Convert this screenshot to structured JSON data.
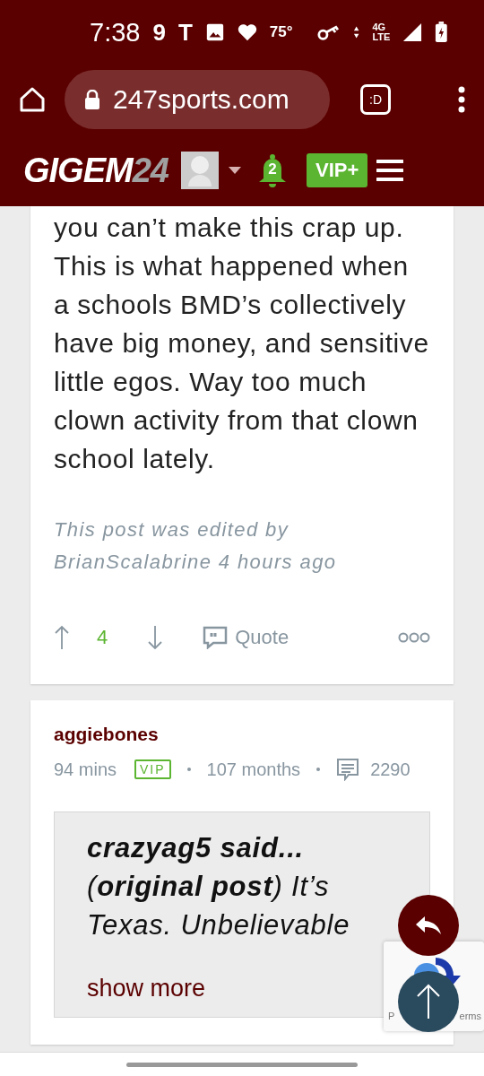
{
  "status_bar": {
    "time": "7:38",
    "notification_glyphs": [
      "9",
      "T"
    ],
    "temperature": "75°",
    "network_top": "4G",
    "network_bottom": "LTE"
  },
  "browser": {
    "url": "247sports.com",
    "tab_label": ":D"
  },
  "site_header": {
    "logo_main": "GIGEM",
    "logo_tail": "24",
    "notification_count": "2",
    "vip_label": "VIP+"
  },
  "posts": [
    {
      "kind": "continued",
      "body": "you can’t make this crap up. This is what happened when a schools BMD’s collectively have big money, and sensitive little egos. Way too much clown activity from that clown school lately.",
      "edited_note": "This post was edited by BrianScalabrine 4 hours ago",
      "votes": "4",
      "quote_label": "Quote"
    },
    {
      "kind": "header",
      "username": "aggiebones",
      "time": "94 mins",
      "badge": "VIP",
      "tenure": "107 months",
      "post_count": "2290",
      "quote": {
        "text": "**crazyag5 said...**\n(**original post**) It’s Texas. Unbelievable",
        "show_more": "show more"
      }
    }
  ],
  "recaptcha": {
    "left_text": "P",
    "right_text": "erms"
  }
}
